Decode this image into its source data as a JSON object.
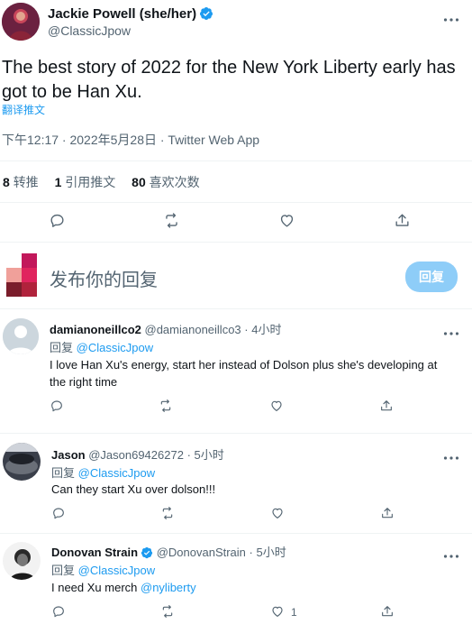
{
  "main_tweet": {
    "author_name": "Jackie Powell (she/her)",
    "author_handle": "@ClassicJpow",
    "text": "The best story of 2022 for the New York Liberty early has got to be Han Xu.",
    "translate_label": "翻译推文",
    "timestamp": "下午12:17 · 2022年5月28日 · Twitter Web App",
    "stats": {
      "retweets_count": "8",
      "retweets_label": "转推",
      "quotes_count": "1",
      "quotes_label": "引用推文",
      "likes_count": "80",
      "likes_label": "喜欢次数"
    }
  },
  "composer": {
    "placeholder": "发布你的回复",
    "button_label": "回复"
  },
  "replies": [
    {
      "author_name": "damianoneillco2",
      "author_handle": "@damianoneillco3",
      "time": "· 4小时",
      "replying_prefix": "回复",
      "replying_to": "@ClassicJpow",
      "text": "I love Han Xu's energy, start her instead of Dolson plus she's developing at the right time",
      "likes": ""
    },
    {
      "author_name": "Jason",
      "author_handle": "@Jason69426272",
      "time": "· 5小时",
      "replying_prefix": "回复",
      "replying_to": "@ClassicJpow",
      "text": "Can they start Xu over dolson!!!",
      "likes": ""
    },
    {
      "author_name": "Donovan Strain",
      "author_handle": "@DonovanStrain",
      "time": "· 5小时",
      "replying_prefix": "回复",
      "replying_to": "@ClassicJpow",
      "text_prefix": "I need Xu merch ",
      "text_mention": "@nyliberty",
      "likes": "1"
    }
  ],
  "colors": {
    "accent": "#1d9bf0",
    "muted": "#536471",
    "divider": "#eff3f4",
    "reply_button_disabled": "#8ecdf8"
  }
}
